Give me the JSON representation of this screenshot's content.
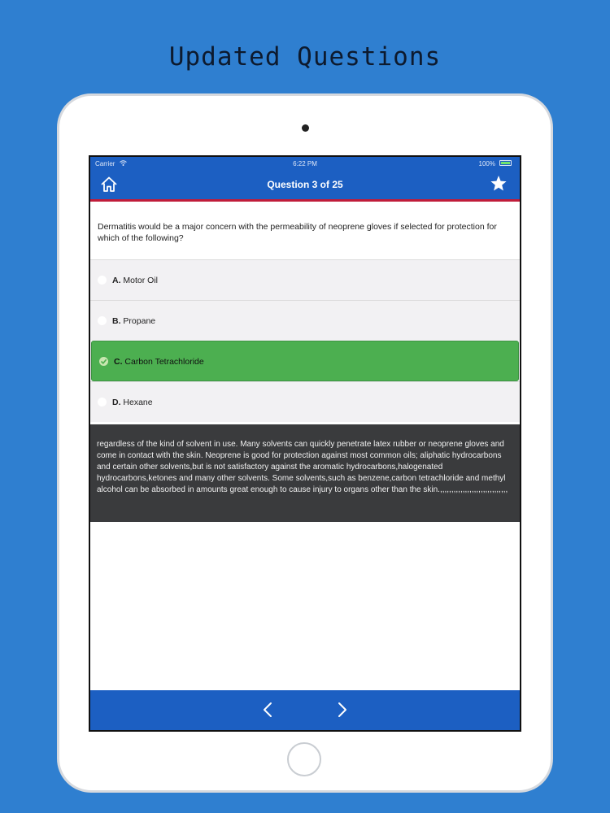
{
  "promo": {
    "title": "Updated Questions"
  },
  "status_bar": {
    "carrier": "Carrier",
    "time": "6:22 PM",
    "battery": "100%"
  },
  "nav": {
    "title": "Question 3 of 25",
    "home_icon": "home-icon",
    "favorite_icon": "star-icon"
  },
  "question": {
    "text": "Dermatitis would be a major concern with the permeability of neoprene gloves if selected for protection for which of the following?"
  },
  "options": [
    {
      "letter": "A.",
      "text": "Motor Oil",
      "selected": false
    },
    {
      "letter": "B.",
      "text": "Propane",
      "selected": false
    },
    {
      "letter": "C.",
      "text": "Carbon Tetrachloride",
      "selected": true
    },
    {
      "letter": "D.",
      "text": "Hexane",
      "selected": false
    }
  ],
  "explanation": {
    "text": "regardless of the kind of solvent in use. Many solvents can quickly penetrate latex rubber or neoprene gloves and come in contact with the skin. Neoprene is good for protection against most common oils; aliphatic hydrocarbons and certain other solvents,but is not satisfactory against the aromatic hydrocarbons,halogenated hydrocarbons,ketones and many other solvents. Some solvents,such as benzene,carbon tetrachloride and methyl alcohol can be absorbed in amounts great enough to cause injury to organs other than the skin.,,,,,,,,,,,,,,,,,,,,,,,,,,,,,,"
  },
  "colors": {
    "background": "#2f7fd0",
    "nav": "#1c5fc2",
    "accent_line": "#c01c3a",
    "selected": "#4caf50",
    "explanation_bg": "#3a3b3d"
  }
}
